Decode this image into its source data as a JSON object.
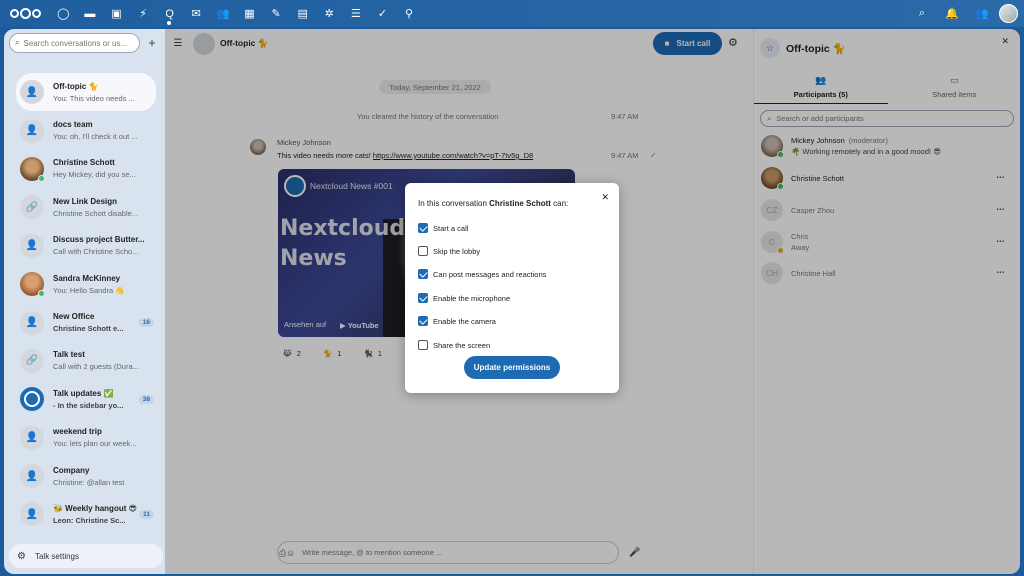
{
  "topbar": {
    "apps": [
      "dashboard-icon",
      "files-icon",
      "photos-icon",
      "activity-icon",
      "talk-icon",
      "mail-icon",
      "contacts-icon",
      "calendar-icon",
      "notes-icon",
      "deck-icon",
      "tasks-apps-icon",
      "tasks-icon",
      "check-icon",
      "maps-icon"
    ],
    "right_icons": [
      "search-icon",
      "notifications-icon",
      "contacts-menu-icon"
    ]
  },
  "sidebar": {
    "search_placeholder": "Search conversations or us...",
    "conversations": [
      {
        "name": "Off-topic 🐈",
        "sub": "You: This video needs ...",
        "avatar": "group",
        "active": true
      },
      {
        "name": "docs team",
        "sub": "You: oh, I'll check it out ...",
        "avatar": "group"
      },
      {
        "name": "Christine Schott",
        "sub": "Hey Mickey, did you se...",
        "avatar": "photo1",
        "online": true
      },
      {
        "name": "New Link Design",
        "sub": "Christine Schott disable...",
        "avatar": "link"
      },
      {
        "name": "Discuss project Butter...",
        "sub": "Call with Christine Scho...",
        "avatar": "group"
      },
      {
        "name": "Sandra McKinney",
        "sub": "You: Hello Sandra 👋",
        "avatar": "photo2",
        "online": true
      },
      {
        "name": "New Office",
        "sub": "Christine Schott e...",
        "avatar": "group",
        "badge": "16",
        "bold_sub": true
      },
      {
        "name": "Talk test",
        "sub": "Call with 2 guests (Dura...",
        "avatar": "link"
      },
      {
        "name": "Talk updates ✅",
        "sub": "- In the sidebar yo...",
        "avatar": "talk",
        "badge": "38",
        "bold_sub": true
      },
      {
        "name": "weekend trip",
        "sub": "You: lets plan our week...",
        "avatar": "group"
      },
      {
        "name": "Company",
        "sub": "Christine: @allan test",
        "avatar": "group"
      },
      {
        "name": "🐝 Weekly hangout 😎",
        "sub": "Leon: Christine Sc...",
        "avatar": "group",
        "badge": "11",
        "bold_sub": true
      }
    ],
    "settings_label": "Talk settings"
  },
  "chat": {
    "title": "Off-topic 🐈",
    "start_call_label": "Start call",
    "date_separator": "Today, September 21, 2022",
    "system_message": "You cleared the history of the conversation",
    "system_time": "9:47 AM",
    "message": {
      "author": "Mickey Johnson",
      "text": "This video needs more cats! ",
      "link": "https://www.youtube.com/watch?v=pT-7tv5g_D8",
      "time": "9:47 AM"
    },
    "video": {
      "title": "Nextcloud News #001",
      "big_line1": "Nextcloud",
      "big_line2": "News",
      "watch_on": "Ansehen auf",
      "youtube": "▶ YouTube"
    },
    "reactions": [
      {
        "emoji": "😹",
        "count": "2"
      },
      {
        "emoji": "🐈",
        "count": "1"
      },
      {
        "emoji": "🐈‍⬛",
        "count": "1"
      }
    ],
    "composer_placeholder": "Write message, @ to mention someone ..."
  },
  "right": {
    "title": "Off-topic 🐈",
    "tabs": [
      {
        "label": "Participants (5)",
        "icon": "participants-icon",
        "active": true
      },
      {
        "label": "Shared items",
        "icon": "shared-items-icon",
        "active": false
      }
    ],
    "search_placeholder": "Search or add participants",
    "participants": [
      {
        "name": "Mickey Johnson",
        "role": "(moderator)",
        "status": "🌴 Working remotely and in a good mood! 😎",
        "avatar": "photo1",
        "presence": "online"
      },
      {
        "name": "Christine Schott",
        "role": "",
        "status": "",
        "avatar": "photo2",
        "presence": "online",
        "more": true
      },
      {
        "name": "Casper Zhou",
        "role": "",
        "status": "",
        "avatar": "CZ",
        "dim": true,
        "more": true
      },
      {
        "name": "Chris",
        "role": "",
        "status": "Away",
        "avatar": "C",
        "presence": "away",
        "dim": true,
        "more": true
      },
      {
        "name": "Christine Hall",
        "role": "",
        "status": "",
        "avatar": "CH",
        "dim": true,
        "more": true
      }
    ]
  },
  "modal": {
    "title_prefix": "In this conversation ",
    "title_user": "Christine Schott",
    "title_suffix": " can:",
    "permissions": [
      {
        "label": "Start a call",
        "checked": true
      },
      {
        "label": "Skip the lobby",
        "checked": false
      },
      {
        "label": "Can post messages and reactions",
        "checked": true
      },
      {
        "label": "Enable the microphone",
        "checked": true
      },
      {
        "label": "Enable the camera",
        "checked": true
      },
      {
        "label": "Share the screen",
        "checked": false
      }
    ],
    "button_label": "Update permissions"
  },
  "colors": {
    "primary": "#1e6ab3",
    "topbar": "#1f5f9f",
    "online": "#46ba61",
    "away": "#f4a331"
  }
}
